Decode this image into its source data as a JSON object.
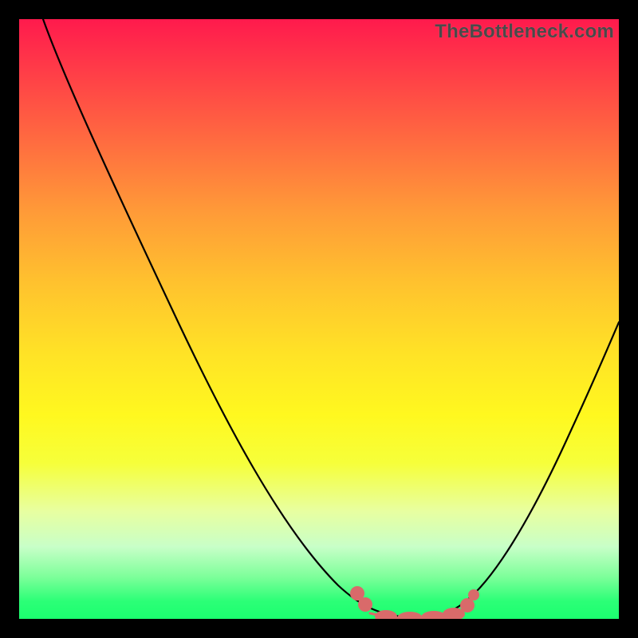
{
  "watermark": "TheBottleneck.com",
  "chart_data": {
    "type": "line",
    "title": "",
    "xlabel": "",
    "ylabel": "",
    "xlim": [
      0,
      100
    ],
    "ylim": [
      0,
      100
    ],
    "series": [
      {
        "name": "bottleneck-curve",
        "x": [
          4,
          10,
          20,
          30,
          40,
          50,
          55,
          58,
          60,
          65,
          70,
          75,
          80,
          90,
          100
        ],
        "y": [
          100,
          91,
          73,
          55,
          37,
          19,
          9,
          3,
          1,
          0,
          0,
          1,
          6,
          25,
          52
        ]
      }
    ],
    "markers": {
      "name": "highlighted-range",
      "color": "#d96a6a",
      "points": [
        {
          "x": 57,
          "y": 4
        },
        {
          "x": 58,
          "y": 2
        },
        {
          "x": 60,
          "y": 0
        },
        {
          "x": 63,
          "y": 0
        },
        {
          "x": 66,
          "y": 0
        },
        {
          "x": 69,
          "y": 0
        },
        {
          "x": 72,
          "y": 0
        },
        {
          "x": 74,
          "y": 1
        },
        {
          "x": 76,
          "y": 3
        }
      ]
    }
  }
}
